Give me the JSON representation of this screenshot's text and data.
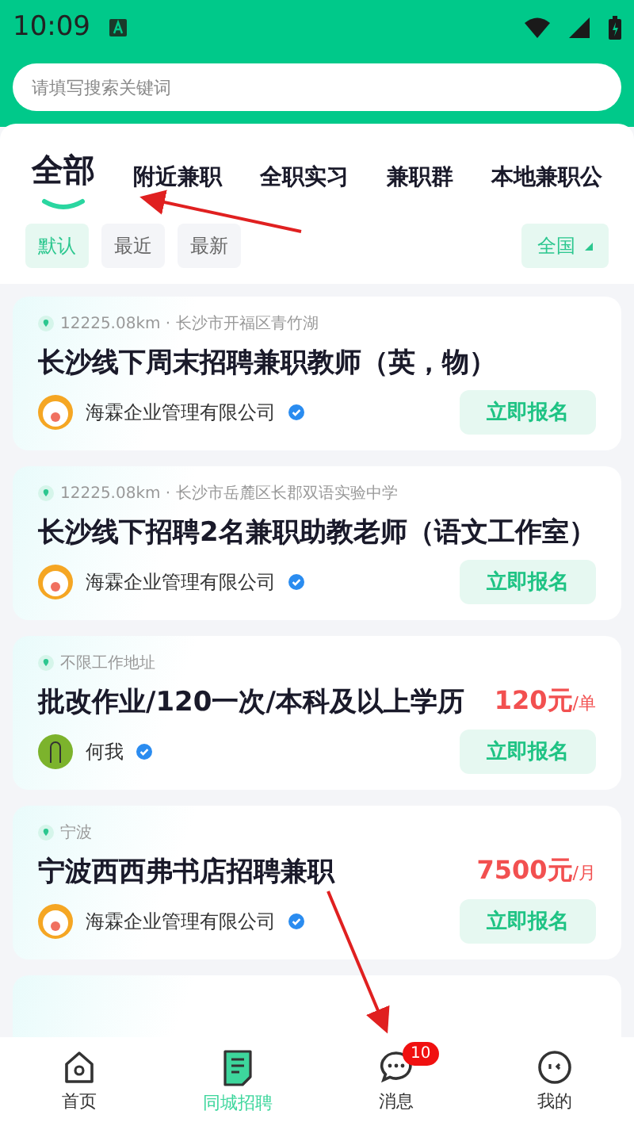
{
  "status_bar": {
    "time": "10:09"
  },
  "search": {
    "placeholder": "请填写搜索关键词"
  },
  "tabs": [
    {
      "label": "全部",
      "selected": true
    },
    {
      "label": "附近兼职",
      "selected": false
    },
    {
      "label": "全职实习",
      "selected": false
    },
    {
      "label": "兼职群",
      "selected": false
    },
    {
      "label": "本地兼职公",
      "selected": false
    }
  ],
  "sort_chips": [
    {
      "label": "默认",
      "selected": true
    },
    {
      "label": "最近",
      "selected": false
    },
    {
      "label": "最新",
      "selected": false
    }
  ],
  "region_filter": {
    "label": "全国"
  },
  "jobs": [
    {
      "location": "12225.08km · 长沙市开福区青竹湖",
      "title": "长沙线下周末招聘兼职教师（英，物）",
      "company": "海霖企业管理有限公司",
      "kind": "cartoon",
      "verified": true,
      "button": "立即报名"
    },
    {
      "location": "12225.08km · 长沙市岳麓区长郡双语实验中学",
      "title": "长沙线下招聘2名兼职助教老师（语文工作室）",
      "company": "海霖企业管理有限公司",
      "kind": "cartoon",
      "verified": true,
      "button": "立即报名"
    },
    {
      "location": "不限工作地址",
      "title": "批改作业/120一次/本科及以上学历",
      "salary": {
        "amount": "120元",
        "unit": "/单"
      },
      "company": "何我",
      "kind": "figure",
      "verified": true,
      "button": "立即报名"
    },
    {
      "location": "宁波",
      "title": "宁波西西弗书店招聘兼职",
      "salary": {
        "amount": "7500元",
        "unit": "/月"
      },
      "company": "海霖企业管理有限公司",
      "kind": "cartoon",
      "verified": true,
      "button": "立即报名"
    }
  ],
  "nav": [
    {
      "label": "首页",
      "selected": false
    },
    {
      "label": "同城招聘",
      "selected": true
    },
    {
      "label": "消息",
      "selected": false,
      "badge": "10"
    },
    {
      "label": "我的",
      "selected": false
    }
  ]
}
